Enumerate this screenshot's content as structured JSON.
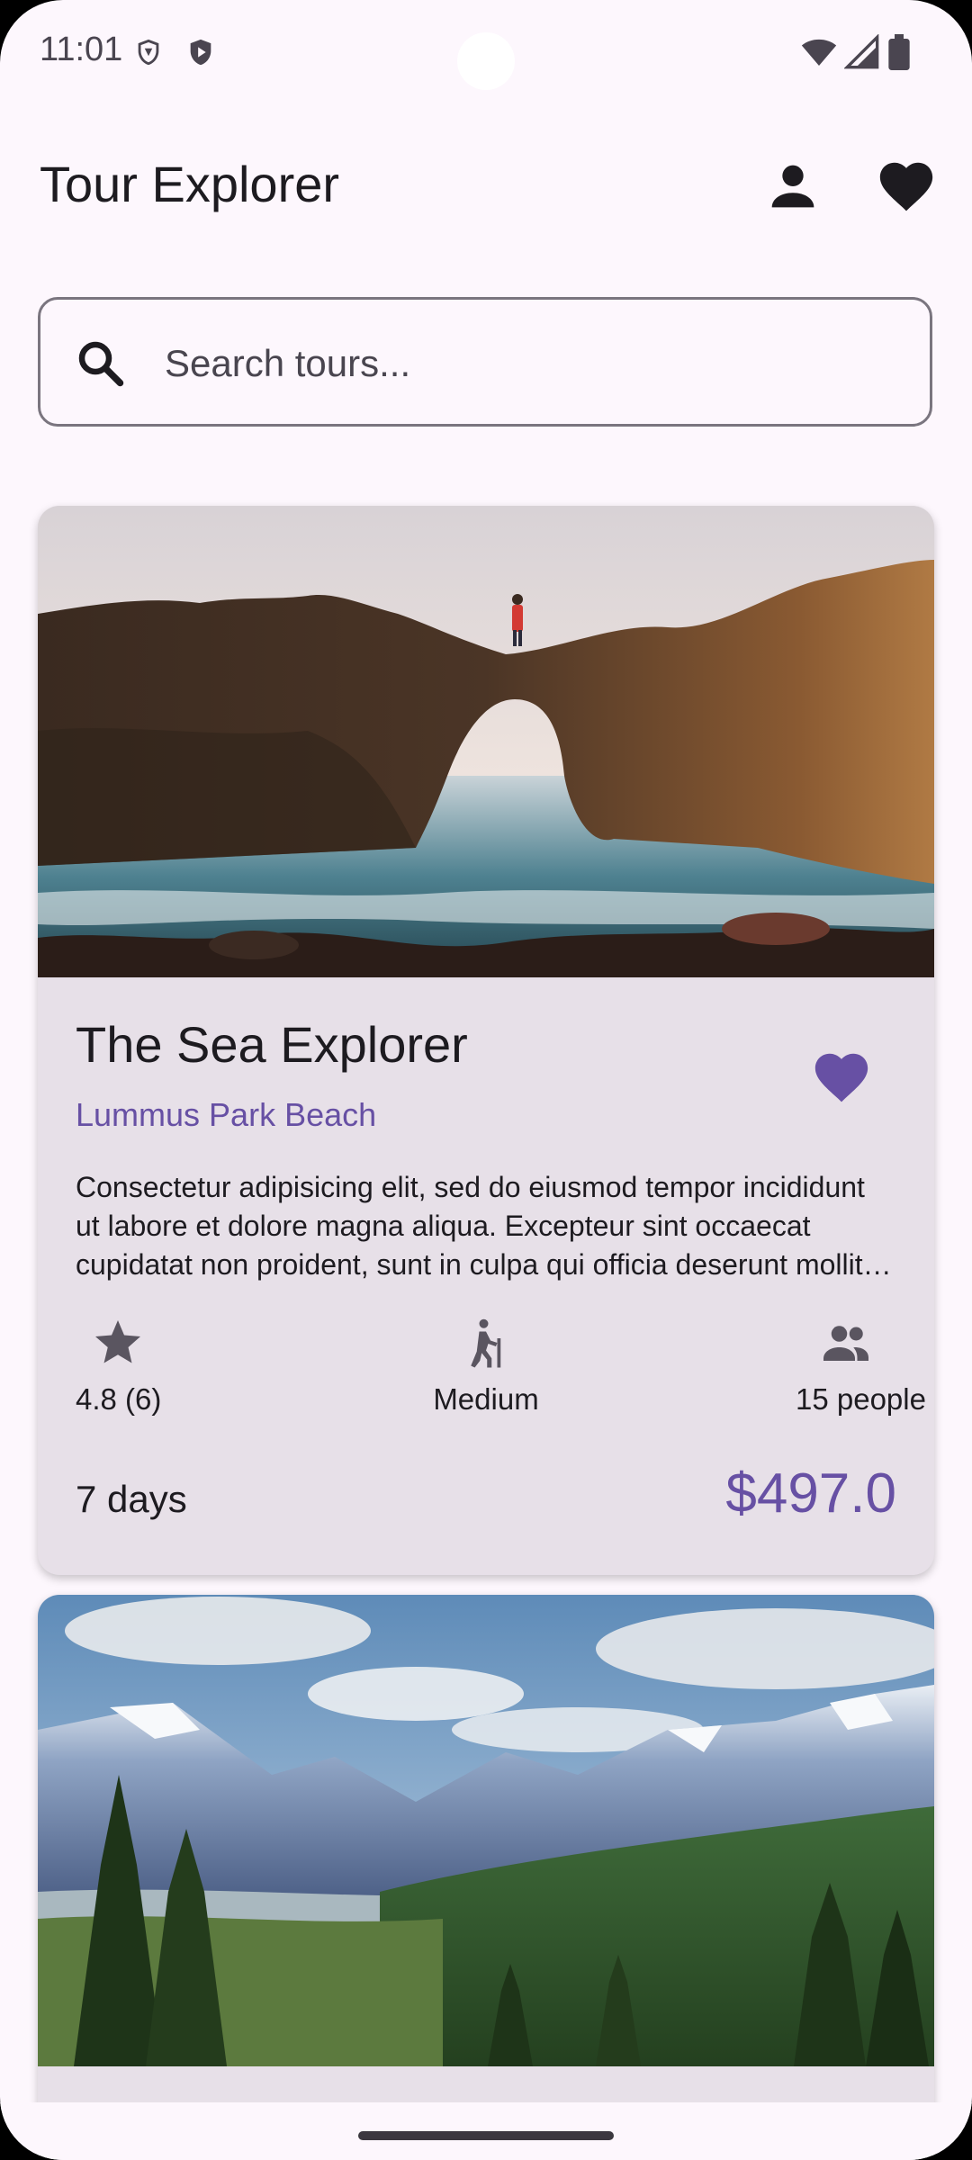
{
  "status_bar": {
    "time": "11:01",
    "icons_left": [
      "vpn-shield-icon",
      "play-protect-icon"
    ],
    "icons_right": [
      "wifi-icon",
      "signal-icon",
      "battery-icon"
    ]
  },
  "app_bar": {
    "title": "Tour Explorer",
    "actions": [
      "profile-icon",
      "favorites-icon"
    ]
  },
  "search": {
    "placeholder": "Search tours...",
    "value": ""
  },
  "tours": [
    {
      "name": "The Sea Explorer",
      "location": "Lummus Park Beach",
      "description": "Consectetur adipisicing elit, sed do eiusmod tempor incididunt ut labore et dolore magna aliqua. Excepteur sint occaecat cupidatat non proident, sunt in culpa qui officia deserunt mollit anim id est laborum.",
      "favorite": true,
      "rating": "4.8 (6)",
      "difficulty": "Medium",
      "group_size": "15 people",
      "duration": "7 days",
      "price": "$497.0",
      "image": "coastal rock arch with hiker"
    },
    {
      "image": "mountain valley with pine forest"
    }
  ],
  "colors": {
    "accent": "#6750a4",
    "card_bg": "#e7e0e8",
    "page_bg": "#fdf7fd",
    "icon": "#49454f"
  }
}
